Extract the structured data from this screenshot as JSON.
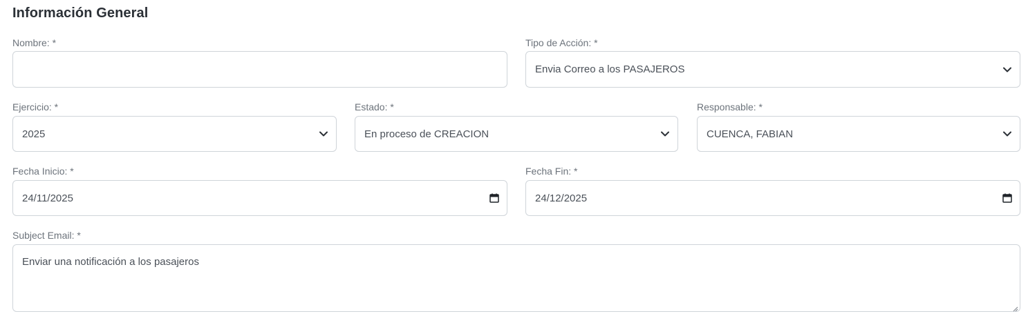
{
  "section": {
    "title": "Información General"
  },
  "form": {
    "nombre": {
      "label": "Nombre: *",
      "value": ""
    },
    "tipo_accion": {
      "label": "Tipo de Acción: *",
      "value": "Envia Correo a los PASAJEROS"
    },
    "ejercicio": {
      "label": "Ejercicio: *",
      "value": "2025"
    },
    "estado": {
      "label": "Estado: *",
      "value": "En proceso de CREACION"
    },
    "responsable": {
      "label": "Responsable: *",
      "value": "CUENCA, FABIAN"
    },
    "fecha_inicio": {
      "label": "Fecha Inicio: *",
      "value": "24/11/2025"
    },
    "fecha_fin": {
      "label": "Fecha Fin: *",
      "value": "24/12/2025"
    },
    "subject_email": {
      "label": "Subject Email: *",
      "value": "Enviar una notificación a los pasajeros"
    }
  },
  "icons": {
    "select": "chevron-down-icon",
    "date": "calendar-icon",
    "resize": "resize-grip-icon"
  },
  "colors": {
    "border": "#cfd4d9",
    "label": "#6c737b",
    "text": "#4a5058",
    "title": "#2b3036"
  }
}
